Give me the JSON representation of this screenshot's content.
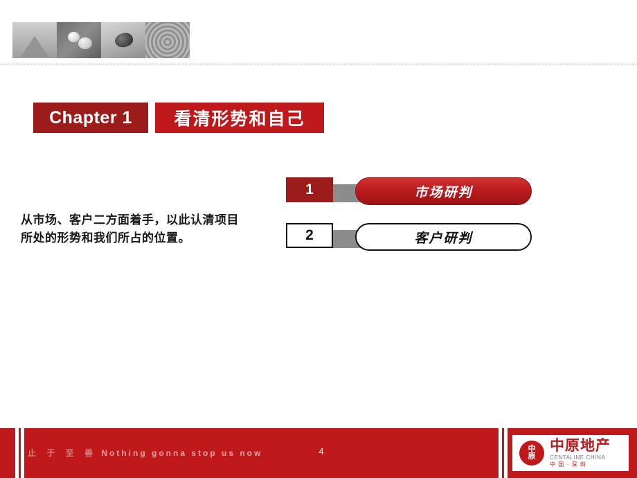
{
  "slide": {
    "page_number": "4",
    "chapter": {
      "badge": "Chapter 1",
      "title": "看清形势和自己"
    },
    "body_text": "从市场、客户二方面着手，以此认清项目所处的形势和我们所占的位置。",
    "items": [
      {
        "number": "1",
        "label": "市场研判",
        "style": "red"
      },
      {
        "number": "2",
        "label": "客户研判",
        "style": "white"
      }
    ],
    "top_strip_tiles": [
      "stone-pyramid-photo",
      "pebbles-photo",
      "dark-stone-photo",
      "tree-rings-photo"
    ],
    "footer": {
      "slogan_cn": "止 于 至 善",
      "slogan_en": "Nothing  gonna  stop  us  now",
      "logo": {
        "mark_top": "中",
        "mark_bottom": "原",
        "name_cn": "中原地产",
        "name_en": "CENTALINE CHINA",
        "name_sub": "中 国 · 深 圳"
      }
    },
    "colors": {
      "brand_red": "#c0191b",
      "dark_red": "#9c1b1b",
      "gray_connector": "#8c8c8c"
    }
  }
}
